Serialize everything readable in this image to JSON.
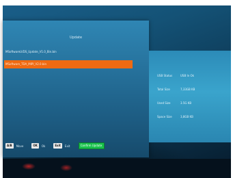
{
  "panel": {
    "title": "Update"
  },
  "files": [
    {
      "label": "MSoftwareLVDS_Update_V1.0_Bin.bin",
      "selected": false
    },
    {
      "label": "MSoftware_TDA_MIPI_V2.0.bin",
      "selected": true
    }
  ],
  "info": [
    {
      "label": "USB Status",
      "value": "USB In Ok"
    },
    {
      "label": "Total Size",
      "value": "7,33GB KB"
    },
    {
      "label": "Used Size",
      "value": "3.5G KB"
    },
    {
      "label": "Space Size",
      "value": "3,8GB KB"
    }
  ],
  "footer": {
    "key1": "A/B",
    "key1_label": "Move",
    "key2": "OK",
    "key2_label": "Ok",
    "key3": "Exit",
    "key3_label": "Exit",
    "green_label": "Confirm Update"
  },
  "colors": {
    "selection": "#ef6a12",
    "green_button": "#19c24c",
    "panel": "#256f99"
  }
}
